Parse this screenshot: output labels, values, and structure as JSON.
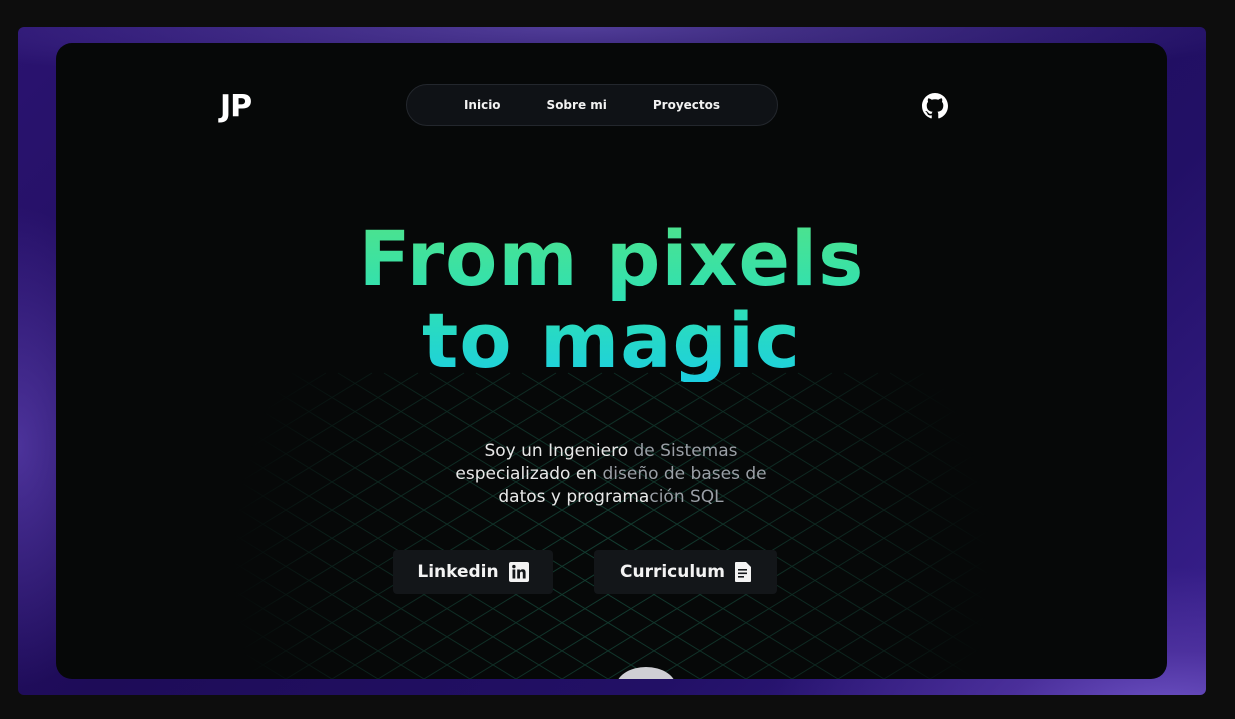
{
  "header": {
    "logo": "JP",
    "nav": [
      {
        "label": "Inicio"
      },
      {
        "label": "Sobre mi"
      },
      {
        "label": "Proyectos"
      }
    ],
    "github_icon": "github-icon"
  },
  "hero": {
    "line1": "From pixels",
    "line2": "to magic",
    "gradient": [
      "#4ee38b",
      "#1ccfe0"
    ]
  },
  "intro": {
    "part1": "Soy un Ingeniero ",
    "part2": "de Sistemas",
    "part3": "especializado en ",
    "part4": "diseño de bases de",
    "part5": "datos y programa",
    "part6": "ción SQL"
  },
  "actions": {
    "linkedin_label": "Linkedin",
    "linkedin_icon": "linkedin-icon",
    "cv_label": "Curriculum",
    "cv_icon": "document-icon"
  },
  "colors": {
    "page_bg": "#0d0d0d",
    "card_bg": "#060808",
    "frame_purple": "#2a1370",
    "grid_line": "#1f6b55"
  }
}
